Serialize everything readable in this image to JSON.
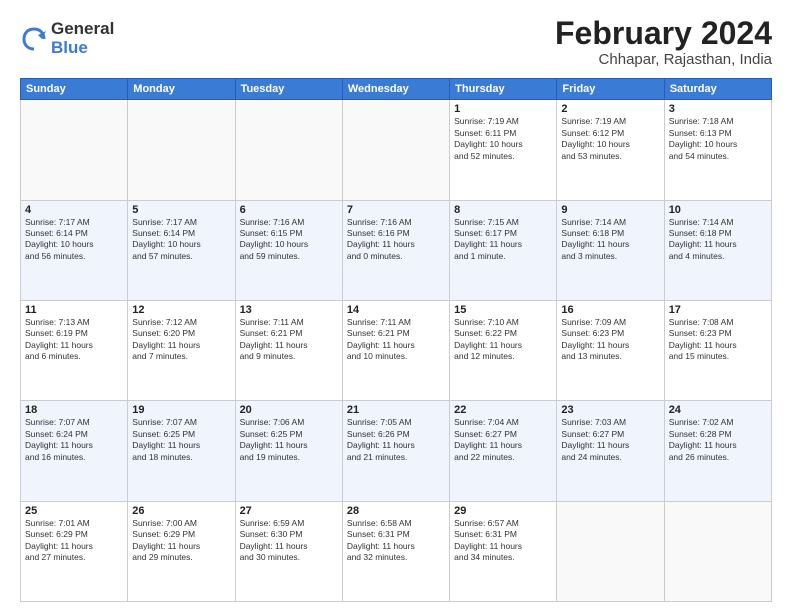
{
  "logo": {
    "general": "General",
    "blue": "Blue"
  },
  "title": "February 2024",
  "location": "Chhapar, Rajasthan, India",
  "days_of_week": [
    "Sunday",
    "Monday",
    "Tuesday",
    "Wednesday",
    "Thursday",
    "Friday",
    "Saturday"
  ],
  "weeks": [
    [
      {
        "day": "",
        "info": ""
      },
      {
        "day": "",
        "info": ""
      },
      {
        "day": "",
        "info": ""
      },
      {
        "day": "",
        "info": ""
      },
      {
        "day": "1",
        "info": "Sunrise: 7:19 AM\nSunset: 6:11 PM\nDaylight: 10 hours\nand 52 minutes."
      },
      {
        "day": "2",
        "info": "Sunrise: 7:19 AM\nSunset: 6:12 PM\nDaylight: 10 hours\nand 53 minutes."
      },
      {
        "day": "3",
        "info": "Sunrise: 7:18 AM\nSunset: 6:13 PM\nDaylight: 10 hours\nand 54 minutes."
      }
    ],
    [
      {
        "day": "4",
        "info": "Sunrise: 7:17 AM\nSunset: 6:14 PM\nDaylight: 10 hours\nand 56 minutes."
      },
      {
        "day": "5",
        "info": "Sunrise: 7:17 AM\nSunset: 6:14 PM\nDaylight: 10 hours\nand 57 minutes."
      },
      {
        "day": "6",
        "info": "Sunrise: 7:16 AM\nSunset: 6:15 PM\nDaylight: 10 hours\nand 59 minutes."
      },
      {
        "day": "7",
        "info": "Sunrise: 7:16 AM\nSunset: 6:16 PM\nDaylight: 11 hours\nand 0 minutes."
      },
      {
        "day": "8",
        "info": "Sunrise: 7:15 AM\nSunset: 6:17 PM\nDaylight: 11 hours\nand 1 minute."
      },
      {
        "day": "9",
        "info": "Sunrise: 7:14 AM\nSunset: 6:18 PM\nDaylight: 11 hours\nand 3 minutes."
      },
      {
        "day": "10",
        "info": "Sunrise: 7:14 AM\nSunset: 6:18 PM\nDaylight: 11 hours\nand 4 minutes."
      }
    ],
    [
      {
        "day": "11",
        "info": "Sunrise: 7:13 AM\nSunset: 6:19 PM\nDaylight: 11 hours\nand 6 minutes."
      },
      {
        "day": "12",
        "info": "Sunrise: 7:12 AM\nSunset: 6:20 PM\nDaylight: 11 hours\nand 7 minutes."
      },
      {
        "day": "13",
        "info": "Sunrise: 7:11 AM\nSunset: 6:21 PM\nDaylight: 11 hours\nand 9 minutes."
      },
      {
        "day": "14",
        "info": "Sunrise: 7:11 AM\nSunset: 6:21 PM\nDaylight: 11 hours\nand 10 minutes."
      },
      {
        "day": "15",
        "info": "Sunrise: 7:10 AM\nSunset: 6:22 PM\nDaylight: 11 hours\nand 12 minutes."
      },
      {
        "day": "16",
        "info": "Sunrise: 7:09 AM\nSunset: 6:23 PM\nDaylight: 11 hours\nand 13 minutes."
      },
      {
        "day": "17",
        "info": "Sunrise: 7:08 AM\nSunset: 6:23 PM\nDaylight: 11 hours\nand 15 minutes."
      }
    ],
    [
      {
        "day": "18",
        "info": "Sunrise: 7:07 AM\nSunset: 6:24 PM\nDaylight: 11 hours\nand 16 minutes."
      },
      {
        "day": "19",
        "info": "Sunrise: 7:07 AM\nSunset: 6:25 PM\nDaylight: 11 hours\nand 18 minutes."
      },
      {
        "day": "20",
        "info": "Sunrise: 7:06 AM\nSunset: 6:25 PM\nDaylight: 11 hours\nand 19 minutes."
      },
      {
        "day": "21",
        "info": "Sunrise: 7:05 AM\nSunset: 6:26 PM\nDaylight: 11 hours\nand 21 minutes."
      },
      {
        "day": "22",
        "info": "Sunrise: 7:04 AM\nSunset: 6:27 PM\nDaylight: 11 hours\nand 22 minutes."
      },
      {
        "day": "23",
        "info": "Sunrise: 7:03 AM\nSunset: 6:27 PM\nDaylight: 11 hours\nand 24 minutes."
      },
      {
        "day": "24",
        "info": "Sunrise: 7:02 AM\nSunset: 6:28 PM\nDaylight: 11 hours\nand 26 minutes."
      }
    ],
    [
      {
        "day": "25",
        "info": "Sunrise: 7:01 AM\nSunset: 6:29 PM\nDaylight: 11 hours\nand 27 minutes."
      },
      {
        "day": "26",
        "info": "Sunrise: 7:00 AM\nSunset: 6:29 PM\nDaylight: 11 hours\nand 29 minutes."
      },
      {
        "day": "27",
        "info": "Sunrise: 6:59 AM\nSunset: 6:30 PM\nDaylight: 11 hours\nand 30 minutes."
      },
      {
        "day": "28",
        "info": "Sunrise: 6:58 AM\nSunset: 6:31 PM\nDaylight: 11 hours\nand 32 minutes."
      },
      {
        "day": "29",
        "info": "Sunrise: 6:57 AM\nSunset: 6:31 PM\nDaylight: 11 hours\nand 34 minutes."
      },
      {
        "day": "",
        "info": ""
      },
      {
        "day": "",
        "info": ""
      }
    ]
  ]
}
